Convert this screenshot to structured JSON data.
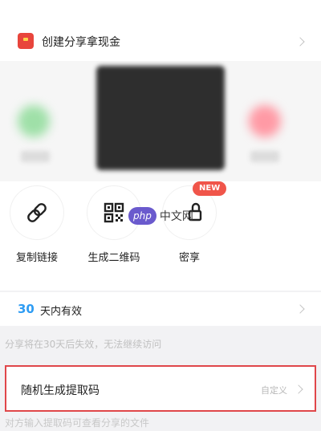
{
  "banner": {
    "title": "创建分享拿现金",
    "icon": "gift-icon",
    "accent": "#e8453c"
  },
  "actions": [
    {
      "label": "复制链接",
      "icon": "link-icon"
    },
    {
      "label": "生成二维码",
      "icon": "qr-code-icon"
    },
    {
      "label": "密享",
      "icon": "lock-icon",
      "badge": "NEW"
    }
  ],
  "watermark": {
    "logo": "php",
    "text": "中文网"
  },
  "validity": {
    "number": "30",
    "text": "天内有效",
    "note": "分享将在30天后失效，无法继续访问",
    "number_color": "#2e9cf3"
  },
  "extraction_code": {
    "label": "随机生成提取码",
    "option": "自定义",
    "highlight_color": "#e0474a",
    "note": "对方输入提取码可查看分享的文件"
  }
}
